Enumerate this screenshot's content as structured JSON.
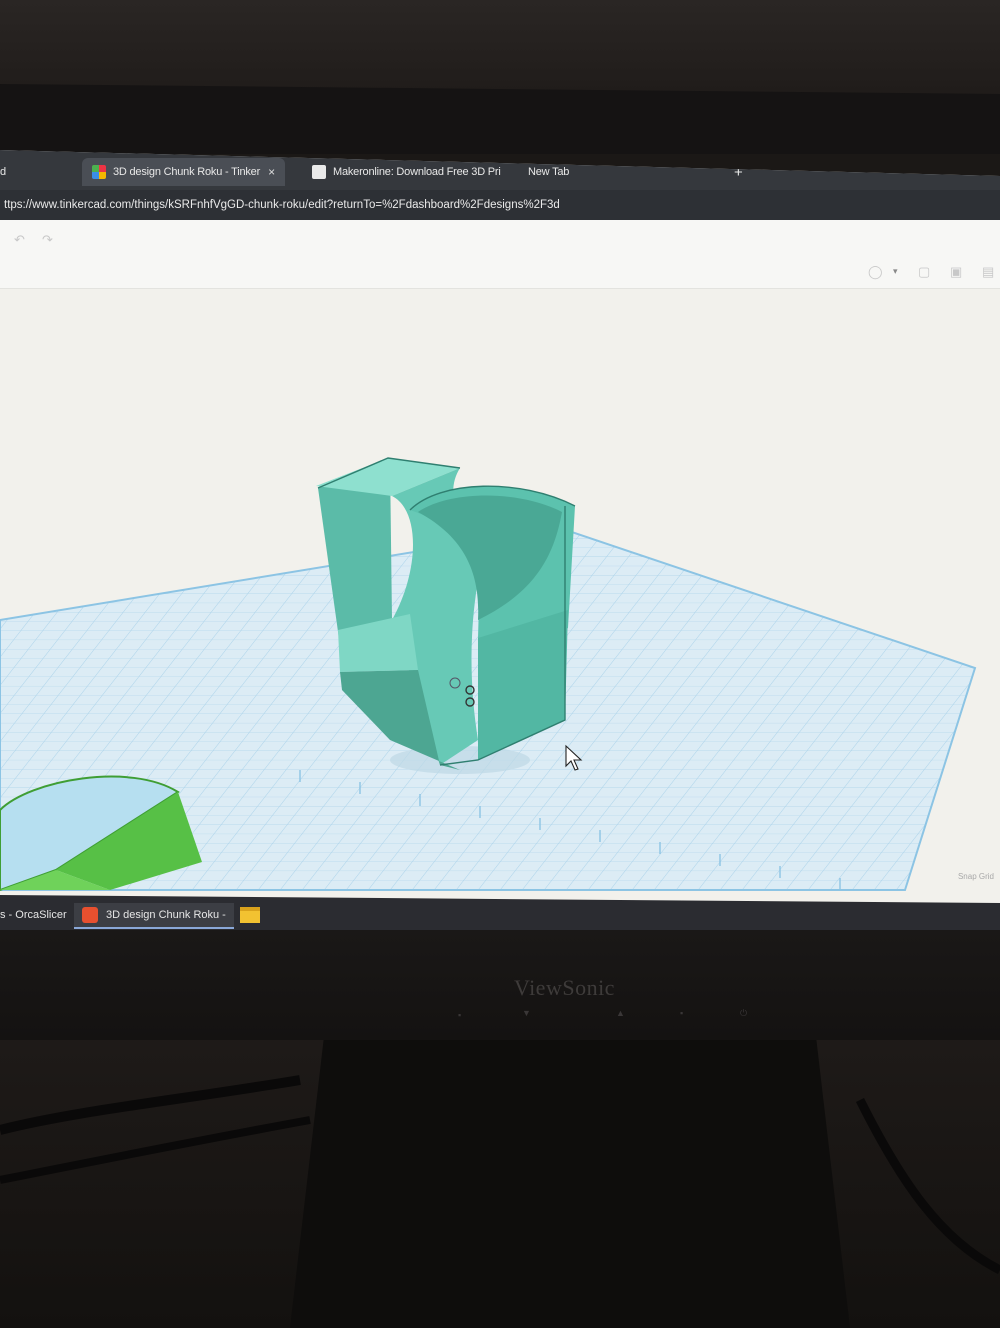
{
  "browser": {
    "tabs": [
      {
        "label": "d",
        "active": false
      },
      {
        "label": "3D design Chunk Roku - Tinker",
        "active": true,
        "close": "×"
      },
      {
        "label": "Makeronline: Download Free 3D Pri",
        "active": false
      },
      {
        "label": "New Tab",
        "active": false
      }
    ],
    "new_tab": "+",
    "url": "ttps://www.tinkercad.com/things/kSRFnhfVgGD-chunk-roku/edit?returnTo=%2Fdashboard%2Fdesigns%2F3d"
  },
  "workplane": {
    "snap_grid_label": "Snap Grid",
    "colors": {
      "grid_fill": "#dcecf5",
      "grid_line": "#9cc9e6",
      "model": "#6fd0bd",
      "model_shade": "#4fae9c",
      "second_shape_top": "#b6dff0",
      "second_shape_side": "#57c046"
    }
  },
  "taskbar": {
    "items": [
      {
        "label": "s - OrcaSlicer",
        "active": false
      },
      {
        "label": "3D design Chunk Roku -",
        "active": true
      },
      {
        "label": "",
        "icon": "folder-icon",
        "active": false
      }
    ]
  },
  "monitor": {
    "brand": "ViewSonic"
  }
}
